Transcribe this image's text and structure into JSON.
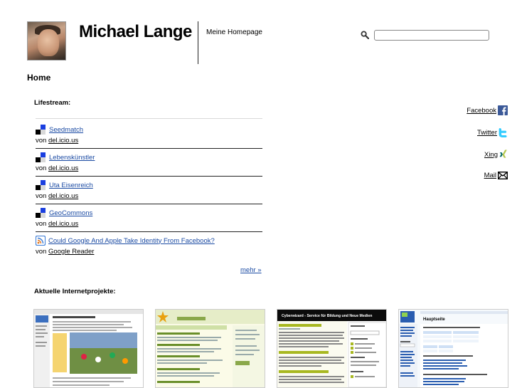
{
  "header": {
    "site_title": "Michael Lange",
    "tagline": "Meine Homepage"
  },
  "search": {
    "placeholder": "",
    "value": ""
  },
  "page": {
    "title": "Home"
  },
  "lifestream": {
    "heading": "Lifestream:",
    "items": [
      {
        "icon": "delicious-icon",
        "title": "Seedmatch",
        "via": "von",
        "source": "del.icio.us"
      },
      {
        "icon": "delicious-icon",
        "title": "Lebenskünstler",
        "via": "von",
        "source": "del.icio.us"
      },
      {
        "icon": "delicious-icon",
        "title": "Uta Eisenreich",
        "via": "von",
        "source": "del.icio.us"
      },
      {
        "icon": "delicious-icon",
        "title": "GeoCommons",
        "via": "von",
        "source": "del.icio.us"
      },
      {
        "icon": "rss-icon",
        "title": "Could Google And Apple Take Identity From Facebook?",
        "via": "von",
        "source": "Google Reader"
      }
    ],
    "more_label": "mehr »"
  },
  "social": [
    {
      "label": "Facebook",
      "icon": "facebook-icon",
      "color": "#3b5998"
    },
    {
      "label": "Twitter",
      "icon": "twitter-icon",
      "color": "#33ccff"
    },
    {
      "label": "Xing",
      "icon": "xing-icon",
      "color": "#006567"
    },
    {
      "label": "Mail",
      "icon": "mail-icon",
      "color": "#000000"
    }
  ],
  "projects": {
    "heading": "Aktuelle Internetprojekte:",
    "thumbnails": [
      {
        "name": "project-thumbnail-1",
        "banner_text": ""
      },
      {
        "name": "project-thumbnail-2",
        "banner_text": ""
      },
      {
        "name": "project-thumbnail-3",
        "banner_text": "Cyberwizard - Service für Bildung und Neue Medien"
      },
      {
        "name": "project-thumbnail-4",
        "banner_text": "Hauptseite"
      }
    ]
  },
  "colors": {
    "link": "#1a4aa3",
    "delicious_blue": "#1a3fe0",
    "rule": "#222222"
  }
}
